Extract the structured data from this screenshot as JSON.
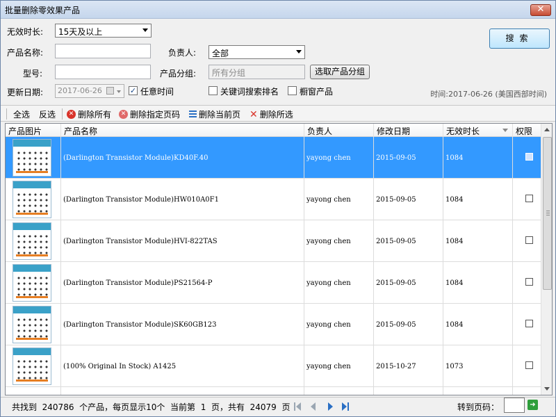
{
  "window": {
    "title": "批量删除零效果产品",
    "close_label": "✕"
  },
  "filters": {
    "expiry_label": "无效时长:",
    "expiry_value": "15天及以上",
    "product_name_label": "产品名称:",
    "product_name_value": "",
    "owner_label": "负责人:",
    "owner_value": "全部",
    "model_label": "型号:",
    "model_value": "",
    "group_label": "产品分组:",
    "group_placeholder": "所有分组",
    "group_button": "选取产品分组",
    "update_date_label": "更新日期:",
    "update_date_value": "2017-06-26",
    "any_time_label": "任意时间",
    "any_time_checked": true,
    "keyword_rank_label": "关键词搜索排名",
    "keyword_rank_checked": false,
    "window_product_label": "橱窗产品",
    "window_product_checked": false,
    "search_button": "搜索",
    "time_info": "时间:2017-06-26 (美国西部时间)"
  },
  "toolbar": {
    "select_all": "全选",
    "invert": "反选",
    "delete_all": "删除所有",
    "delete_pages": "删除指定页码",
    "delete_current": "删除当前页",
    "delete_selected": "删除所选"
  },
  "table": {
    "columns": [
      "产品图片",
      "产品名称",
      "负责人",
      "修改日期",
      "无效时长",
      "权限"
    ],
    "rows": [
      {
        "name": "(Darlington Transistor Module)KD40F.40",
        "owner": "yayong chen",
        "date": "2015-09-05",
        "duration": "1084",
        "selected": true
      },
      {
        "name": "(Darlington Transistor Module)HW010A0F1",
        "owner": "yayong chen",
        "date": "2015-09-05",
        "duration": "1084",
        "selected": false
      },
      {
        "name": "(Darlington Transistor Module)HVI-822TAS",
        "owner": "yayong chen",
        "date": "2015-09-05",
        "duration": "1084",
        "selected": false
      },
      {
        "name": "(Darlington Transistor Module)PS21564-P",
        "owner": "yayong chen",
        "date": "2015-09-05",
        "duration": "1084",
        "selected": false
      },
      {
        "name": "(Darlington Transistor Module)SK60GB123",
        "owner": "yayong chen",
        "date": "2015-09-05",
        "duration": "1084",
        "selected": false
      },
      {
        "name": "(100% Original In Stock) A1425",
        "owner": "yayong chen",
        "date": "2015-10-27",
        "duration": "1073",
        "selected": false
      }
    ]
  },
  "status": {
    "found_prefix": "共找到",
    "total_products": "240786",
    "found_suffix": "个产品，每页显示10个",
    "current_prefix": "当前第",
    "current_page": "1",
    "current_mid": "页，共有",
    "total_pages": "24079",
    "pages_suffix": "页",
    "goto_label": "转到页码：",
    "goto_value": ""
  }
}
